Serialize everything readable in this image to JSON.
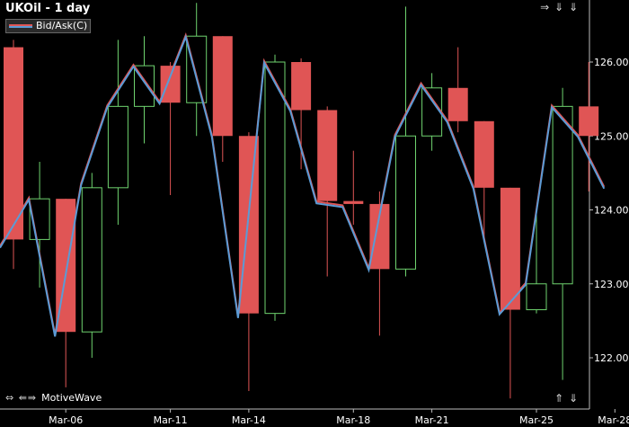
{
  "header": {
    "title": "UKOil - 1 day",
    "legend_label": "Bid/Ask(C)"
  },
  "footer": {
    "brand": "MotiveWave",
    "left_arrows": [
      "⇔",
      "⇚⇛"
    ],
    "top_nav": [
      "⇒",
      "⇓",
      "⇓"
    ],
    "bottom_nav": [
      "⇑",
      "⇓"
    ]
  },
  "colors": {
    "background": "#000000",
    "up_candle_border": "#6fd36f",
    "down_candle": "#e05555",
    "bid_line": "#e05555",
    "ask_line": "#5b9bd5",
    "axis": "#bbbbbb"
  },
  "chart_data": {
    "type": "candlestick",
    "title": "UKOil - 1 day",
    "y_ticks": [
      122.0,
      123.0,
      124.0,
      125.0,
      126.0
    ],
    "y_tick_labels": [
      "122.00",
      "123.00",
      "124.00",
      "125.00",
      "126.00"
    ],
    "ylim": [
      121.4,
      126.8
    ],
    "x_tick_labels": [
      "Mar-06",
      "Mar-11",
      "Mar-14",
      "Mar-18",
      "Mar-21",
      "Mar-25",
      "Mar-28"
    ],
    "x_tick_bar_index": [
      2,
      6,
      9,
      13,
      16,
      20,
      23
    ],
    "legend": [
      {
        "name": "Bid/Ask(C)",
        "position": "top-left"
      }
    ],
    "candles": [
      {
        "open": 126.2,
        "high": 126.3,
        "low": 123.2,
        "close": 123.6
      },
      {
        "open": 123.6,
        "high": 124.65,
        "low": 122.95,
        "close": 124.15
      },
      {
        "open": 124.15,
        "high": 124.15,
        "low": 121.6,
        "close": 122.35
      },
      {
        "open": 122.35,
        "high": 124.5,
        "low": 122.0,
        "close": 124.3
      },
      {
        "open": 124.3,
        "high": 126.3,
        "low": 123.8,
        "close": 125.4
      },
      {
        "open": 125.4,
        "high": 126.35,
        "low": 124.9,
        "close": 125.95
      },
      {
        "open": 125.95,
        "high": 126.0,
        "low": 124.2,
        "close": 125.45
      },
      {
        "open": 125.45,
        "high": 126.8,
        "low": 125.0,
        "close": 126.35
      },
      {
        "open": 126.35,
        "high": 126.35,
        "low": 124.65,
        "close": 125.0
      },
      {
        "open": 125.0,
        "high": 125.05,
        "low": 121.55,
        "close": 122.6
      },
      {
        "open": 122.6,
        "high": 126.1,
        "low": 122.5,
        "close": 126.0
      },
      {
        "open": 126.0,
        "high": 126.05,
        "low": 124.55,
        "close": 125.35
      },
      {
        "open": 125.35,
        "high": 125.4,
        "low": 123.1,
        "close": 124.12
      },
      {
        "open": 124.12,
        "high": 124.8,
        "low": 123.8,
        "close": 124.08
      },
      {
        "open": 124.08,
        "high": 124.25,
        "low": 122.3,
        "close": 123.2
      },
      {
        "open": 123.2,
        "high": 126.75,
        "low": 123.1,
        "close": 125.0
      },
      {
        "open": 125.0,
        "high": 125.85,
        "low": 124.8,
        "close": 125.65
      },
      {
        "open": 125.65,
        "high": 126.2,
        "low": 125.05,
        "close": 125.2
      },
      {
        "open": 125.2,
        "high": 125.2,
        "low": 123.6,
        "close": 124.3
      },
      {
        "open": 124.3,
        "high": 124.3,
        "low": 121.45,
        "close": 122.65
      },
      {
        "open": 122.65,
        "high": 124.05,
        "low": 122.6,
        "close": 123.0
      },
      {
        "open": 123.0,
        "high": 125.65,
        "low": 121.7,
        "close": 125.4
      },
      {
        "open": 125.4,
        "high": 126.0,
        "low": 124.25,
        "close": 125.0
      }
    ],
    "bid_ask_line": [
      123.5,
      124.15,
      122.3,
      124.35,
      125.4,
      125.95,
      125.45,
      126.35,
      125.0,
      122.55,
      126.0,
      125.35,
      124.1,
      124.05,
      123.2,
      125.0,
      125.7,
      125.2,
      124.3,
      122.6,
      123.0,
      125.4,
      125.0,
      124.3
    ]
  }
}
